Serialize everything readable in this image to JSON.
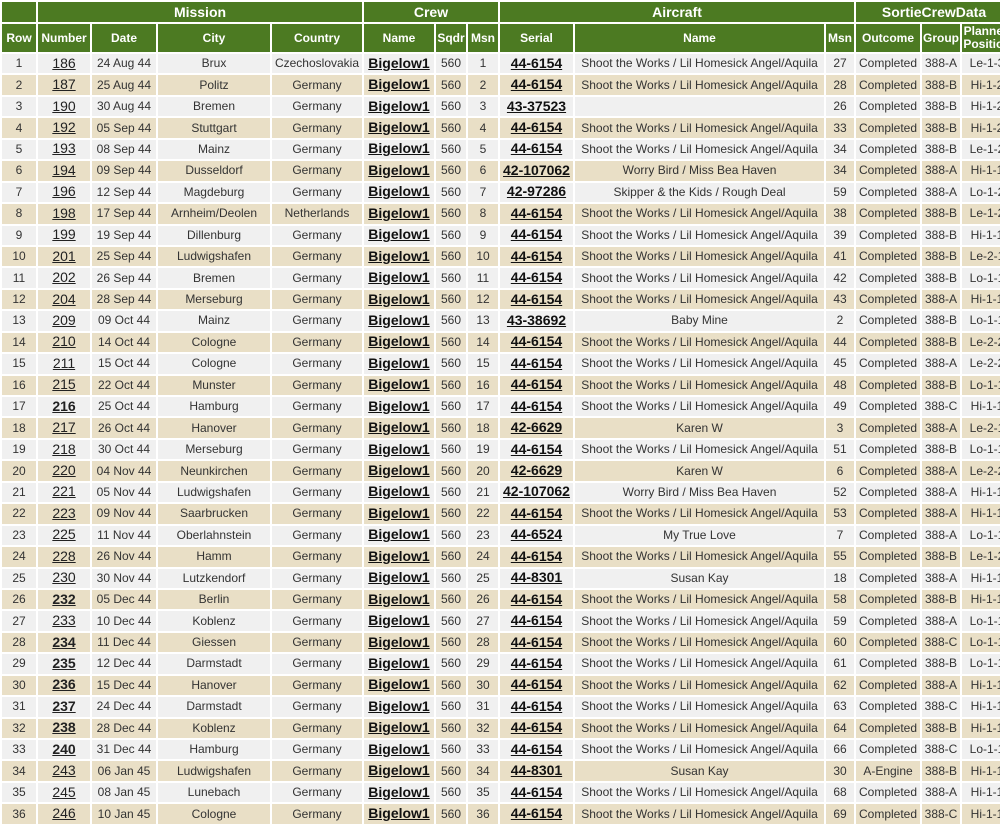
{
  "groups": {
    "mission": "Mission",
    "crew": "Crew",
    "aircraft": "Aircraft",
    "sortie": "SortieCrewData"
  },
  "columns": {
    "row": "Row",
    "number": "Number",
    "date": "Date",
    "city": "City",
    "country": "Country",
    "crew_name": "Name",
    "sqdr": "Sqdr",
    "msn": "Msn",
    "serial": "Serial",
    "ac_name": "Name",
    "ac_msn": "Msn",
    "outcome": "Outcome",
    "group": "Group",
    "planned": "Planned Position"
  },
  "colors": {
    "header_bg": "#4c7a22",
    "row_odd": "#f0f0f0",
    "row_even": "#e9dfc6"
  },
  "rows": [
    {
      "row": "1",
      "number": "186",
      "number_bold": false,
      "date": "24 Aug 44",
      "city": "Brux",
      "country": "Czechoslovakia",
      "crew": "Bigelow1",
      "sqdr": "560",
      "msn": "1",
      "serial": "44-6154",
      "ac_name": "Shoot the Works / Lil Homesick Angel/Aquila",
      "ac_msn": "27",
      "outcome": "Completed",
      "group": "388-A",
      "planned": "Le-1-3"
    },
    {
      "row": "2",
      "number": "187",
      "number_bold": false,
      "date": "25 Aug 44",
      "city": "Politz",
      "country": "Germany",
      "crew": "Bigelow1",
      "sqdr": "560",
      "msn": "2",
      "serial": "44-6154",
      "ac_name": "Shoot the Works / Lil Homesick Angel/Aquila",
      "ac_msn": "28",
      "outcome": "Completed",
      "group": "388-B",
      "planned": "Hi-1-2"
    },
    {
      "row": "3",
      "number": "190",
      "number_bold": false,
      "date": "30 Aug 44",
      "city": "Bremen",
      "country": "Germany",
      "crew": "Bigelow1",
      "sqdr": "560",
      "msn": "3",
      "serial": "43-37523",
      "ac_name": "",
      "ac_msn": "26",
      "outcome": "Completed",
      "group": "388-B",
      "planned": "Hi-1-2"
    },
    {
      "row": "4",
      "number": "192",
      "number_bold": false,
      "date": "05 Sep 44",
      "city": "Stuttgart",
      "country": "Germany",
      "crew": "Bigelow1",
      "sqdr": "560",
      "msn": "4",
      "serial": "44-6154",
      "ac_name": "Shoot the Works / Lil Homesick Angel/Aquila",
      "ac_msn": "33",
      "outcome": "Completed",
      "group": "388-B",
      "planned": "Hi-1-2"
    },
    {
      "row": "5",
      "number": "193",
      "number_bold": false,
      "date": "08 Sep 44",
      "city": "Mainz",
      "country": "Germany",
      "crew": "Bigelow1",
      "sqdr": "560",
      "msn": "5",
      "serial": "44-6154",
      "ac_name": "Shoot the Works / Lil Homesick Angel/Aquila",
      "ac_msn": "34",
      "outcome": "Completed",
      "group": "388-B",
      "planned": "Le-1-2"
    },
    {
      "row": "6",
      "number": "194",
      "number_bold": false,
      "date": "09 Sep 44",
      "city": "Dusseldorf",
      "country": "Germany",
      "crew": "Bigelow1",
      "sqdr": "560",
      "msn": "6",
      "serial": "42-107062",
      "ac_name": "Worry Bird / Miss Bea Haven",
      "ac_msn": "34",
      "outcome": "Completed",
      "group": "388-A",
      "planned": "Hi-1-1"
    },
    {
      "row": "7",
      "number": "196",
      "number_bold": false,
      "date": "12 Sep 44",
      "city": "Magdeburg",
      "country": "Germany",
      "crew": "Bigelow1",
      "sqdr": "560",
      "msn": "7",
      "serial": "42-97286",
      "ac_name": "Skipper & the Kids / Rough Deal",
      "ac_msn": "59",
      "outcome": "Completed",
      "group": "388-A",
      "planned": "Lo-1-2"
    },
    {
      "row": "8",
      "number": "198",
      "number_bold": false,
      "date": "17 Sep 44",
      "city": "Arnheim/Deolen",
      "country": "Netherlands",
      "crew": "Bigelow1",
      "sqdr": "560",
      "msn": "8",
      "serial": "44-6154",
      "ac_name": "Shoot the Works / Lil Homesick Angel/Aquila",
      "ac_msn": "38",
      "outcome": "Completed",
      "group": "388-B",
      "planned": "Le-1-2"
    },
    {
      "row": "9",
      "number": "199",
      "number_bold": false,
      "date": "19 Sep 44",
      "city": "Dillenburg",
      "country": "Germany",
      "crew": "Bigelow1",
      "sqdr": "560",
      "msn": "9",
      "serial": "44-6154",
      "ac_name": "Shoot the Works / Lil Homesick Angel/Aquila",
      "ac_msn": "39",
      "outcome": "Completed",
      "group": "388-B",
      "planned": "Hi-1-1"
    },
    {
      "row": "10",
      "number": "201",
      "number_bold": false,
      "date": "25 Sep 44",
      "city": "Ludwigshafen",
      "country": "Germany",
      "crew": "Bigelow1",
      "sqdr": "560",
      "msn": "10",
      "serial": "44-6154",
      "ac_name": "Shoot the Works / Lil Homesick Angel/Aquila",
      "ac_msn": "41",
      "outcome": "Completed",
      "group": "388-B",
      "planned": "Le-2-1"
    },
    {
      "row": "11",
      "number": "202",
      "number_bold": false,
      "date": "26 Sep 44",
      "city": "Bremen",
      "country": "Germany",
      "crew": "Bigelow1",
      "sqdr": "560",
      "msn": "11",
      "serial": "44-6154",
      "ac_name": "Shoot the Works / Lil Homesick Angel/Aquila",
      "ac_msn": "42",
      "outcome": "Completed",
      "group": "388-B",
      "planned": "Lo-1-1"
    },
    {
      "row": "12",
      "number": "204",
      "number_bold": false,
      "date": "28 Sep 44",
      "city": "Merseburg",
      "country": "Germany",
      "crew": "Bigelow1",
      "sqdr": "560",
      "msn": "12",
      "serial": "44-6154",
      "ac_name": "Shoot the Works / Lil Homesick Angel/Aquila",
      "ac_msn": "43",
      "outcome": "Completed",
      "group": "388-A",
      "planned": "Hi-1-1"
    },
    {
      "row": "13",
      "number": "209",
      "number_bold": false,
      "date": "09 Oct 44",
      "city": "Mainz",
      "country": "Germany",
      "crew": "Bigelow1",
      "sqdr": "560",
      "msn": "13",
      "serial": "43-38692",
      "ac_name": "Baby Mine",
      "ac_msn": "2",
      "outcome": "Completed",
      "group": "388-B",
      "planned": "Lo-1-1"
    },
    {
      "row": "14",
      "number": "210",
      "number_bold": false,
      "date": "14 Oct 44",
      "city": "Cologne",
      "country": "Germany",
      "crew": "Bigelow1",
      "sqdr": "560",
      "msn": "14",
      "serial": "44-6154",
      "ac_name": "Shoot the Works / Lil Homesick Angel/Aquila",
      "ac_msn": "44",
      "outcome": "Completed",
      "group": "388-B",
      "planned": "Le-2-2"
    },
    {
      "row": "15",
      "number": "211",
      "number_bold": false,
      "date": "15 Oct 44",
      "city": "Cologne",
      "country": "Germany",
      "crew": "Bigelow1",
      "sqdr": "560",
      "msn": "15",
      "serial": "44-6154",
      "ac_name": "Shoot the Works / Lil Homesick Angel/Aquila",
      "ac_msn": "45",
      "outcome": "Completed",
      "group": "388-A",
      "planned": "Le-2-2"
    },
    {
      "row": "16",
      "number": "215",
      "number_bold": false,
      "date": "22 Oct 44",
      "city": "Munster",
      "country": "Germany",
      "crew": "Bigelow1",
      "sqdr": "560",
      "msn": "16",
      "serial": "44-6154",
      "ac_name": "Shoot the Works / Lil Homesick Angel/Aquila",
      "ac_msn": "48",
      "outcome": "Completed",
      "group": "388-B",
      "planned": "Lo-1-1"
    },
    {
      "row": "17",
      "number": "216",
      "number_bold": true,
      "date": "25 Oct 44",
      "city": "Hamburg",
      "country": "Germany",
      "crew": "Bigelow1",
      "sqdr": "560",
      "msn": "17",
      "serial": "44-6154",
      "ac_name": "Shoot the Works / Lil Homesick Angel/Aquila",
      "ac_msn": "49",
      "outcome": "Completed",
      "group": "388-C",
      "planned": "Hi-1-1"
    },
    {
      "row": "18",
      "number": "217",
      "number_bold": false,
      "date": "26 Oct 44",
      "city": "Hanover",
      "country": "Germany",
      "crew": "Bigelow1",
      "sqdr": "560",
      "msn": "18",
      "serial": "42-6629",
      "ac_name": "Karen W",
      "ac_msn": "3",
      "outcome": "Completed",
      "group": "388-A",
      "planned": "Le-2-1"
    },
    {
      "row": "19",
      "number": "218",
      "number_bold": false,
      "date": "30 Oct 44",
      "city": "Merseburg",
      "country": "Germany",
      "crew": "Bigelow1",
      "sqdr": "560",
      "msn": "19",
      "serial": "44-6154",
      "ac_name": "Shoot the Works / Lil Homesick Angel/Aquila",
      "ac_msn": "51",
      "outcome": "Completed",
      "group": "388-B",
      "planned": "Lo-1-1"
    },
    {
      "row": "20",
      "number": "220",
      "number_bold": false,
      "date": "04 Nov 44",
      "city": "Neunkirchen",
      "country": "Germany",
      "crew": "Bigelow1",
      "sqdr": "560",
      "msn": "20",
      "serial": "42-6629",
      "ac_name": "Karen W",
      "ac_msn": "6",
      "outcome": "Completed",
      "group": "388-A",
      "planned": "Le-2-2"
    },
    {
      "row": "21",
      "number": "221",
      "number_bold": false,
      "date": "05 Nov 44",
      "city": "Ludwigshafen",
      "country": "Germany",
      "crew": "Bigelow1",
      "sqdr": "560",
      "msn": "21",
      "serial": "42-107062",
      "ac_name": "Worry Bird / Miss Bea Haven",
      "ac_msn": "52",
      "outcome": "Completed",
      "group": "388-A",
      "planned": "Hi-1-1"
    },
    {
      "row": "22",
      "number": "223",
      "number_bold": false,
      "date": "09 Nov 44",
      "city": "Saarbrucken",
      "country": "Germany",
      "crew": "Bigelow1",
      "sqdr": "560",
      "msn": "22",
      "serial": "44-6154",
      "ac_name": "Shoot the Works / Lil Homesick Angel/Aquila",
      "ac_msn": "53",
      "outcome": "Completed",
      "group": "388-A",
      "planned": "Hi-1-1"
    },
    {
      "row": "23",
      "number": "225",
      "number_bold": false,
      "date": "11 Nov 44",
      "city": "Oberlahnstein",
      "country": "Germany",
      "crew": "Bigelow1",
      "sqdr": "560",
      "msn": "23",
      "serial": "44-6524",
      "ac_name": "My True Love",
      "ac_msn": "7",
      "outcome": "Completed",
      "group": "388-A",
      "planned": "Lo-1-1"
    },
    {
      "row": "24",
      "number": "228",
      "number_bold": false,
      "date": "26 Nov 44",
      "city": "Hamm",
      "country": "Germany",
      "crew": "Bigelow1",
      "sqdr": "560",
      "msn": "24",
      "serial": "44-6154",
      "ac_name": "Shoot the Works / Lil Homesick Angel/Aquila",
      "ac_msn": "55",
      "outcome": "Completed",
      "group": "388-B",
      "planned": "Le-1-2"
    },
    {
      "row": "25",
      "number": "230",
      "number_bold": false,
      "date": "30 Nov 44",
      "city": "Lutzkendorf",
      "country": "Germany",
      "crew": "Bigelow1",
      "sqdr": "560",
      "msn": "25",
      "serial": "44-8301",
      "ac_name": "Susan Kay",
      "ac_msn": "18",
      "outcome": "Completed",
      "group": "388-A",
      "planned": "Hi-1-1"
    },
    {
      "row": "26",
      "number": "232",
      "number_bold": true,
      "date": "05 Dec 44",
      "city": "Berlin",
      "country": "Germany",
      "crew": "Bigelow1",
      "sqdr": "560",
      "msn": "26",
      "serial": "44-6154",
      "ac_name": "Shoot the Works / Lil Homesick Angel/Aquila",
      "ac_msn": "58",
      "outcome": "Completed",
      "group": "388-B",
      "planned": "Hi-1-1"
    },
    {
      "row": "27",
      "number": "233",
      "number_bold": false,
      "date": "10 Dec 44",
      "city": "Koblenz",
      "country": "Germany",
      "crew": "Bigelow1",
      "sqdr": "560",
      "msn": "27",
      "serial": "44-6154",
      "ac_name": "Shoot the Works / Lil Homesick Angel/Aquila",
      "ac_msn": "59",
      "outcome": "Completed",
      "group": "388-A",
      "planned": "Lo-1-1"
    },
    {
      "row": "28",
      "number": "234",
      "number_bold": true,
      "date": "11 Dec 44",
      "city": "Giessen",
      "country": "Germany",
      "crew": "Bigelow1",
      "sqdr": "560",
      "msn": "28",
      "serial": "44-6154",
      "ac_name": "Shoot the Works / Lil Homesick Angel/Aquila",
      "ac_msn": "60",
      "outcome": "Completed",
      "group": "388-C",
      "planned": "Lo-1-1"
    },
    {
      "row": "29",
      "number": "235",
      "number_bold": true,
      "date": "12 Dec 44",
      "city": "Darmstadt",
      "country": "Germany",
      "crew": "Bigelow1",
      "sqdr": "560",
      "msn": "29",
      "serial": "44-6154",
      "ac_name": "Shoot the Works / Lil Homesick Angel/Aquila",
      "ac_msn": "61",
      "outcome": "Completed",
      "group": "388-B",
      "planned": "Lo-1-1"
    },
    {
      "row": "30",
      "number": "236",
      "number_bold": true,
      "date": "15 Dec 44",
      "city": "Hanover",
      "country": "Germany",
      "crew": "Bigelow1",
      "sqdr": "560",
      "msn": "30",
      "serial": "44-6154",
      "ac_name": "Shoot the Works / Lil Homesick Angel/Aquila",
      "ac_msn": "62",
      "outcome": "Completed",
      "group": "388-A",
      "planned": "Hi-1-1"
    },
    {
      "row": "31",
      "number": "237",
      "number_bold": true,
      "date": "24 Dec 44",
      "city": "Darmstadt",
      "country": "Germany",
      "crew": "Bigelow1",
      "sqdr": "560",
      "msn": "31",
      "serial": "44-6154",
      "ac_name": "Shoot the Works / Lil Homesick Angel/Aquila",
      "ac_msn": "63",
      "outcome": "Completed",
      "group": "388-C",
      "planned": "Hi-1-1"
    },
    {
      "row": "32",
      "number": "238",
      "number_bold": true,
      "date": "28 Dec 44",
      "city": "Koblenz",
      "country": "Germany",
      "crew": "Bigelow1",
      "sqdr": "560",
      "msn": "32",
      "serial": "44-6154",
      "ac_name": "Shoot the Works / Lil Homesick Angel/Aquila",
      "ac_msn": "64",
      "outcome": "Completed",
      "group": "388-B",
      "planned": "Hi-1-1"
    },
    {
      "row": "33",
      "number": "240",
      "number_bold": true,
      "date": "31 Dec 44",
      "city": "Hamburg",
      "country": "Germany",
      "crew": "Bigelow1",
      "sqdr": "560",
      "msn": "33",
      "serial": "44-6154",
      "ac_name": "Shoot the Works / Lil Homesick Angel/Aquila",
      "ac_msn": "66",
      "outcome": "Completed",
      "group": "388-C",
      "planned": "Lo-1-1"
    },
    {
      "row": "34",
      "number": "243",
      "number_bold": false,
      "date": "06 Jan 45",
      "city": "Ludwigshafen",
      "country": "Germany",
      "crew": "Bigelow1",
      "sqdr": "560",
      "msn": "34",
      "serial": "44-8301",
      "ac_name": "Susan Kay",
      "ac_msn": "30",
      "outcome": "A-Engine",
      "group": "388-B",
      "planned": "Hi-1-1"
    },
    {
      "row": "35",
      "number": "245",
      "number_bold": false,
      "date": "08 Jan 45",
      "city": "Lunebach",
      "country": "Germany",
      "crew": "Bigelow1",
      "sqdr": "560",
      "msn": "35",
      "serial": "44-6154",
      "ac_name": "Shoot the Works / Lil Homesick Angel/Aquila",
      "ac_msn": "68",
      "outcome": "Completed",
      "group": "388-A",
      "planned": "Hi-1-1"
    },
    {
      "row": "36",
      "number": "246",
      "number_bold": false,
      "date": "10 Jan 45",
      "city": "Cologne",
      "country": "Germany",
      "crew": "Bigelow1",
      "sqdr": "560",
      "msn": "36",
      "serial": "44-6154",
      "ac_name": "Shoot the Works / Lil Homesick Angel/Aquila",
      "ac_msn": "69",
      "outcome": "Completed",
      "group": "388-C",
      "planned": "Hi-1-1"
    }
  ]
}
